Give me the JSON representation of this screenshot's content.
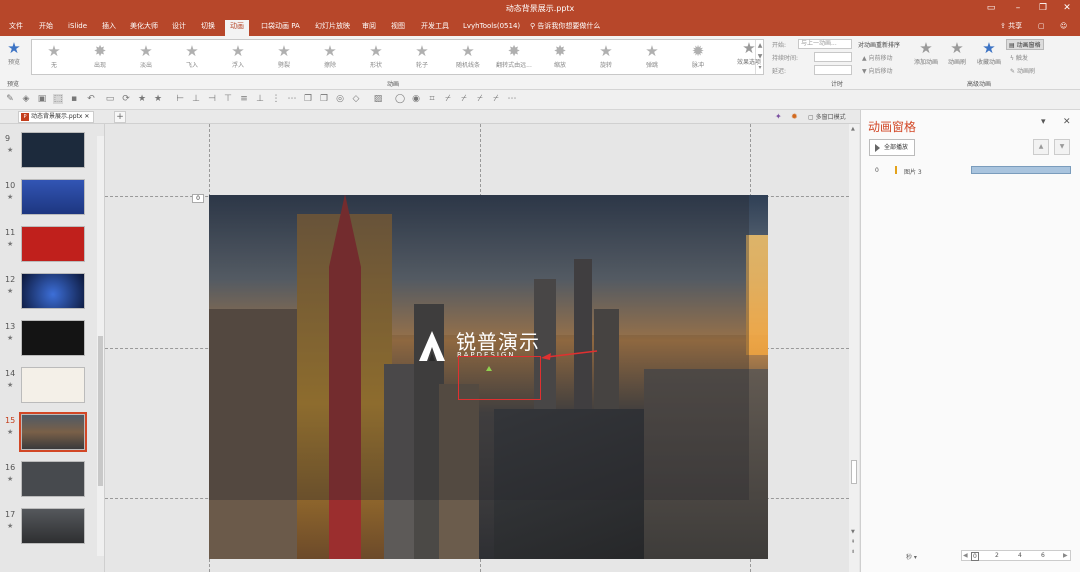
{
  "window": {
    "title": "动态背景展示.pptx",
    "share_label": "共享"
  },
  "menu": {
    "tabs": [
      "文件",
      "开始",
      "iSlide",
      "插入",
      "美化大师",
      "设计",
      "切换",
      "动画",
      "口袋动画 PA",
      "幻灯片放映",
      "审阅",
      "视图",
      "开发工具",
      "LvyhTools(0514)"
    ],
    "active": "动画",
    "tell_me": "告诉我你想要做什么"
  },
  "ribbon": {
    "preview_label": "预览",
    "preview_group": "预览",
    "animations": [
      "无",
      "出现",
      "淡出",
      "飞入",
      "浮入",
      "劈裂",
      "擦除",
      "形状",
      "轮子",
      "随机线条",
      "翻转式由远...",
      "缩放",
      "旋转",
      "弹跳",
      "脉冲"
    ],
    "animation_group": "动画",
    "effect_options": "效果选项",
    "timing": {
      "start_label": "开始:",
      "start_value": "与上一动画...",
      "duration_label": "持续时间:",
      "delay_label": "延迟:",
      "group": "计时"
    },
    "reorder": {
      "title": "对动画重新排序",
      "earlier": "向前移动",
      "later": "向后移动"
    },
    "advanced": {
      "add": "添加动画",
      "painter": "动画刷",
      "favorite": "收藏动画",
      "pane": "动画窗格",
      "trigger": "触发",
      "brush": "动画刷",
      "group": "高级动画"
    }
  },
  "doc_tab": {
    "filename": "动态背景展示.pptx",
    "multi_window": "多窗口模式"
  },
  "thumbnails": [
    {
      "num": "9",
      "bg": "#1c2a3c"
    },
    {
      "num": "10",
      "bg": "#2b4aa0"
    },
    {
      "num": "11",
      "bg": "#c0201c"
    },
    {
      "num": "12",
      "bg": "#0f1f4a"
    },
    {
      "num": "13",
      "bg": "#141414"
    },
    {
      "num": "14",
      "bg": "#f4f0e8"
    },
    {
      "num": "15",
      "bg": "#4a4740"
    },
    {
      "num": "16",
      "bg": "#474a4e"
    },
    {
      "num": "17",
      "bg": "#3b3c3e"
    }
  ],
  "thumb_star": "★",
  "slide": {
    "logo_cn": "锐普演示",
    "logo_en": "RAPDESIGN",
    "anim_tag": "0"
  },
  "pane": {
    "title": "动画窗格",
    "play_all": "全部播放",
    "items": [
      {
        "index": "0",
        "label": "图片 3"
      }
    ],
    "seconds": "秒",
    "ruler": [
      "0",
      "2",
      "4",
      "6"
    ]
  }
}
